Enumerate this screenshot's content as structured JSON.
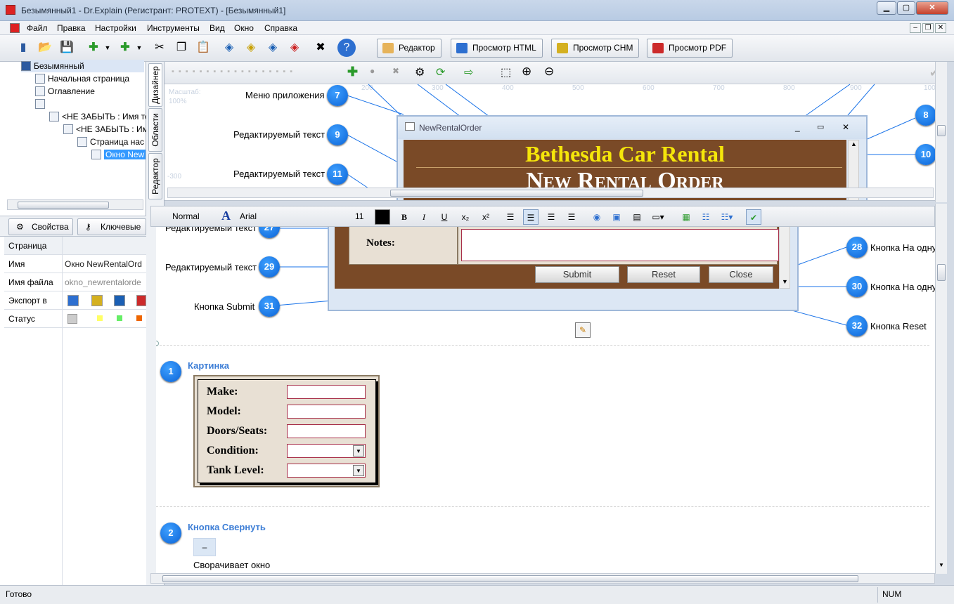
{
  "window": {
    "title": "Безымянный1 - Dr.Explain (Регистрант: PROTEXT) - [Безымянный1]"
  },
  "menu": [
    "Файл",
    "Правка",
    "Настройки",
    "Инструменты",
    "Вид",
    "Окно",
    "Справка"
  ],
  "toolbar": {
    "tabs": [
      "Редактор",
      "Просмотр HTML",
      "Просмотр CHM",
      "Просмотр PDF"
    ]
  },
  "tree": {
    "items": [
      "Безымянный",
      "Начальная страница",
      "Оглавление",
      "<НЕ ЗАБЫТЬ : Имя те",
      "<НЕ ЗАБЫТЬ : Им",
      "Страница нас",
      "Окно New"
    ]
  },
  "props": {
    "tabs": [
      "Свойства",
      "Ключевые с"
    ],
    "section": "Страница",
    "rows": [
      {
        "key": "Имя",
        "value": "Окно NewRentalOrd"
      },
      {
        "key": "Имя файла",
        "value": "okno_newrentalorde"
      },
      {
        "key": "Экспорт в",
        "value": ""
      },
      {
        "key": "Статус",
        "value": ""
      }
    ]
  },
  "vtabs": [
    "Дизайнер",
    "Области",
    "Редактор"
  ],
  "designer": {
    "zoom_label": "Масштаб:",
    "zoom_value": "100%",
    "ruler": [
      "200",
      "300",
      "400",
      "500",
      "600",
      "700",
      "800",
      "900",
      "100"
    ],
    "ruler_left": "-300",
    "callouts": [
      {
        "n": "7",
        "label": "Меню приложения"
      },
      {
        "n": "9",
        "label": "Редактируемый текст"
      },
      {
        "n": "11",
        "label": "Редактируемый текст"
      },
      {
        "n": "8",
        "label": ""
      },
      {
        "n": "10",
        "label": ""
      }
    ],
    "window_title": "NewRentalOrder",
    "company": "Bethesda Car Rental",
    "form_title": "New Rental Order"
  },
  "format": {
    "style": "Normal",
    "font": "Arial",
    "size": "11"
  },
  "editor": {
    "callouts": [
      {
        "n": "27",
        "label": "Редактируемый текст"
      },
      {
        "n": "29",
        "label": "Редактируемый текст"
      },
      {
        "n": "31",
        "label": "Кнопка Submit"
      },
      {
        "n": "28",
        "label": "Кнопка На одну"
      },
      {
        "n": "30",
        "label": "Кнопка На одну"
      },
      {
        "n": "32",
        "label": "Кнопка Reset"
      }
    ],
    "notes_label": "Notes:",
    "buttons": [
      "Submit",
      "Reset",
      "Close"
    ],
    "sections": [
      {
        "n": "1",
        "title": "Картинка"
      },
      {
        "n": "2",
        "title": "Кнопка Свернуть",
        "text": "Сворачивает окно",
        "button": "–"
      }
    ],
    "picture_fields": [
      "Make:",
      "Model:",
      "Doors/Seats:",
      "Condition:",
      "Tank Level:"
    ]
  },
  "status": {
    "left": "Готово",
    "num": "NUM"
  },
  "colors": {
    "accent": "#0b63d6",
    "form_brown": "#7a4a27",
    "company_yellow": "#f5e60a"
  }
}
